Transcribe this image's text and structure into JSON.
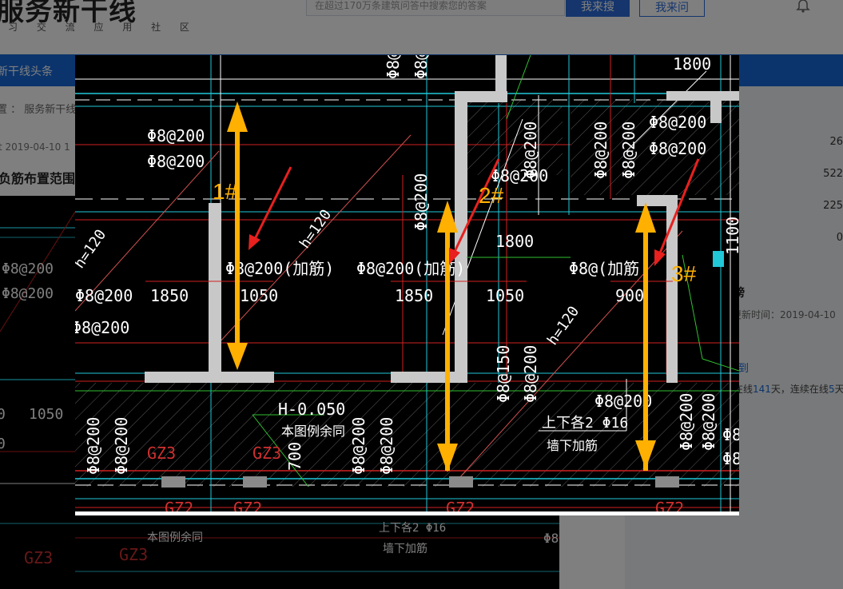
{
  "site": {
    "logo": "服务新干线",
    "slogan": "习 交 流 应 用 社 区",
    "search_placeholder": "在超过170万条建筑问答中搜索您的答案",
    "search_button": "我来搜",
    "ask_button": "我来问",
    "bell_icon": "bell-icon"
  },
  "nav": {
    "item": "新干线头条"
  },
  "breadcrumb": "置 ： 服务新干线",
  "post": {
    "meta": "t   2019-04-10 1",
    "title": "负筋布置范围"
  },
  "sidebar": {
    "stats": [
      "26",
      "522",
      "225",
      "0"
    ],
    "rank_title": "榜",
    "rank_updated": "更新时间：2019-04-10",
    "signin": "到",
    "online_prefix": "在线",
    "online_days": "141",
    "online_mid": "天，连续在线",
    "online_streak": "5",
    "online_suffix": "天"
  },
  "drawing": {
    "labels": {
      "rebar_200": "Φ8@200",
      "rebar_150": "Φ8@150",
      "rebar_add": "Φ8@200(加筋)",
      "rebar_add_short": "Φ8@(加筋",
      "dim_1850": "1850",
      "dim_1050": "1050",
      "dim_900": "900",
      "dim_1800": "1800",
      "dim_700": "700",
      "dim_1100": "1100",
      "slab": "h=120",
      "elevation": "H-0.050",
      "same_note": "本图例余同",
      "col_gz3": "GZ3",
      "col_gz2": "GZ2",
      "wall_bar": "上下各2 Φ16",
      "wall_note": "墙下加筋",
      "cut_0": "0",
      "cut_phi8": "Φ8"
    },
    "markers": [
      "1#",
      "2#",
      "3#"
    ],
    "colors": {
      "background": "#000000",
      "arrow": "#ffb000",
      "pointer": "#e8201e",
      "marker": "#ffb000",
      "wall": "#c8c8c8",
      "red_line": "#d02020",
      "cyan_line": "#20c8d8",
      "white_line": "#ffffff",
      "green_line": "#30c030"
    }
  }
}
